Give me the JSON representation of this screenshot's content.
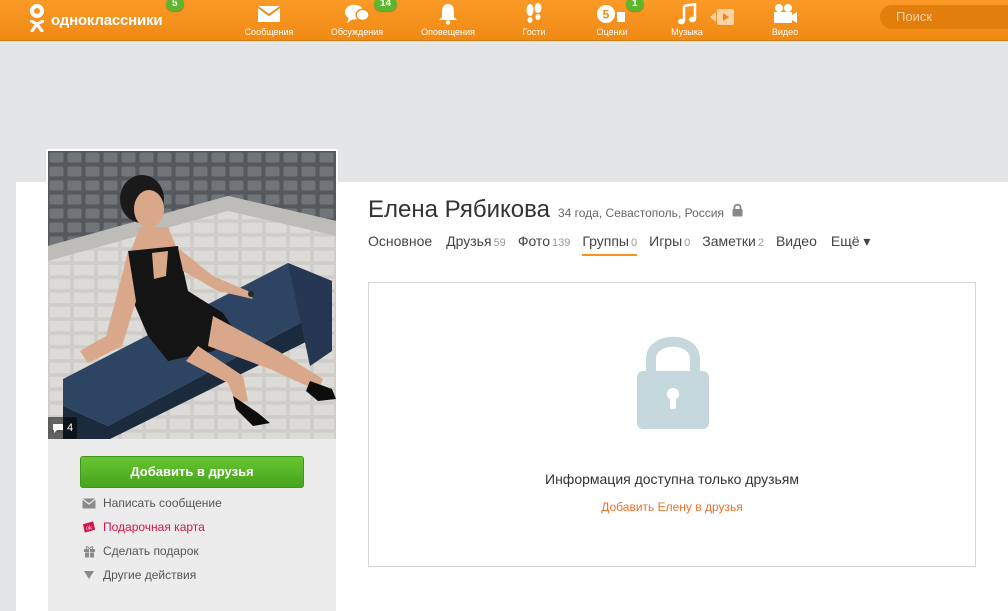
{
  "header": {
    "brand": "одноклассники",
    "brand_badge": "5",
    "nav": [
      {
        "label": "Сообщения",
        "badge": ""
      },
      {
        "label": "Обсуждения",
        "badge": "14"
      },
      {
        "label": "Оповещения",
        "badge": ""
      },
      {
        "label": "Гости",
        "badge": ""
      },
      {
        "label": "Оценки",
        "badge": "1",
        "inline_count": "5"
      },
      {
        "label": "Музыка",
        "badge": ""
      },
      {
        "label": "Видео",
        "badge": ""
      }
    ],
    "search_placeholder": "Поиск"
  },
  "profile": {
    "name": "Елена Рябикова",
    "meta": "34 года, Севастополь, Россия",
    "photo_comments": "4",
    "add_friend_label": "Добавить в друзья",
    "actions": [
      {
        "label": "Написать сообщение",
        "icon": "envelope-icon"
      },
      {
        "label": "Подарочная карта",
        "icon": "gift-card-icon"
      },
      {
        "label": "Сделать подарок",
        "icon": "gift-icon"
      },
      {
        "label": "Другие действия",
        "icon": "triangle-down-icon"
      }
    ],
    "tabs": [
      {
        "label": "Основное",
        "count": ""
      },
      {
        "label": "Друзья",
        "count": "59"
      },
      {
        "label": "Фото",
        "count": "139"
      },
      {
        "label": "Группы",
        "count": "0",
        "active": true
      },
      {
        "label": "Игры",
        "count": "0"
      },
      {
        "label": "Заметки",
        "count": "2"
      },
      {
        "label": "Видео",
        "count": ""
      },
      {
        "label": "Ещё ▾",
        "count": ""
      }
    ]
  },
  "private_panel": {
    "message": "Информация доступна только друзьям",
    "link": "Добавить Елену в друзья"
  },
  "colors": {
    "brand_orange": "#f7931e",
    "badge_green": "#5db72c",
    "button_green": "#52b125",
    "link_orange": "#eb722e",
    "lock_blue": "#c5d8de"
  }
}
